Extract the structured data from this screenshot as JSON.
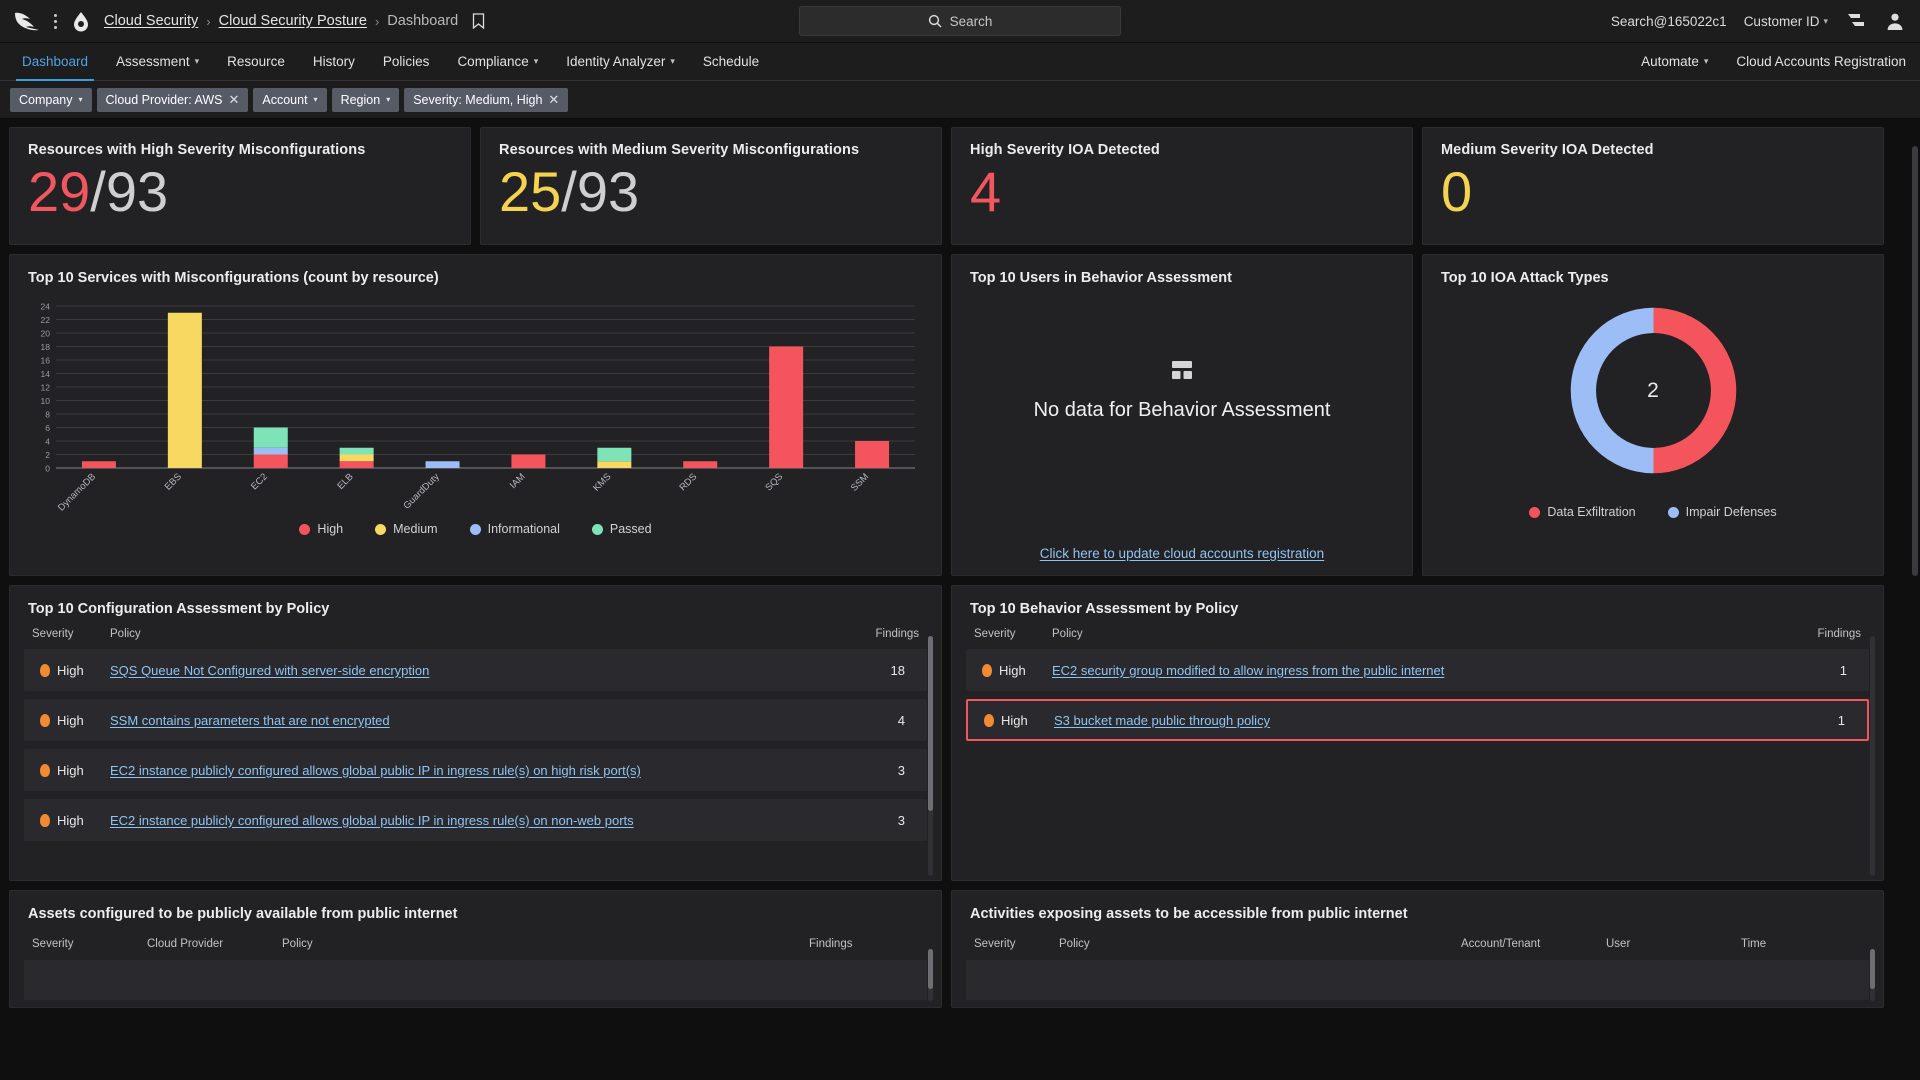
{
  "topbar": {
    "logo_icon": "falcon-logo",
    "menu_icon": "kebab-menu-icon",
    "product_icon": "cloud-security-shield-icon",
    "breadcrumb": [
      {
        "label": "Cloud Security",
        "link": true
      },
      {
        "label": "Cloud Security Posture",
        "link": true
      },
      {
        "label": "Dashboard",
        "link": false
      }
    ],
    "separator": "›",
    "bookmark_icon": "bookmark-icon",
    "search_placeholder": "Search",
    "search_icon": "search-icon",
    "search_value": "",
    "user_search": "Search@165022c1",
    "customer_id_label": "Customer ID",
    "chevron": "∨",
    "list_icon": "list-view-icon",
    "avatar_icon": "user-avatar-icon"
  },
  "nav": {
    "items": [
      {
        "label": "Dashboard",
        "active": true,
        "caret": false
      },
      {
        "label": "Assessment",
        "active": false,
        "caret": true
      },
      {
        "label": "Resource",
        "active": false,
        "caret": false
      },
      {
        "label": "History",
        "active": false,
        "caret": false
      },
      {
        "label": "Policies",
        "active": false,
        "caret": false
      },
      {
        "label": "Compliance",
        "active": false,
        "caret": true
      },
      {
        "label": "Identity Analyzer",
        "active": false,
        "caret": true
      },
      {
        "label": "Schedule",
        "active": false,
        "caret": false
      }
    ],
    "right_items": [
      {
        "label": "Automate",
        "caret": true
      },
      {
        "label": "Cloud Accounts Registration",
        "caret": false
      }
    ]
  },
  "filters": [
    {
      "label": "Company",
      "caret": true,
      "clear": false
    },
    {
      "label": "Cloud Provider: AWS",
      "caret": false,
      "clear": true
    },
    {
      "label": "Account",
      "caret": true,
      "clear": false
    },
    {
      "label": "Region",
      "caret": true,
      "clear": false
    },
    {
      "label": "Severity: Medium, High",
      "caret": false,
      "clear": true
    }
  ],
  "kpis": [
    {
      "title": "Resources with High Severity Misconfigurations",
      "value": "29",
      "denominator": "/93",
      "color": "#f2575f"
    },
    {
      "title": "Resources with Medium Severity Misconfigurations",
      "value": "25",
      "denominator": "/93",
      "color": "#f5d34e"
    },
    {
      "title": "High Severity IOA Detected",
      "value": "4",
      "denominator": "",
      "color": "#f2575f"
    },
    {
      "title": "Medium Severity IOA Detected",
      "value": "0",
      "denominator": "",
      "color": "#f5d34e"
    }
  ],
  "services_chart": {
    "title": "Top 10 Services with Misconfigurations (count by resource)"
  },
  "behavior_users": {
    "title": "Top 10 Users in Behavior Assessment",
    "empty_icon": "no-data-table-icon",
    "empty_text": "No data for Behavior Assessment",
    "link": "Click here to update cloud accounts registration"
  },
  "ioa_attacks": {
    "title": "Top 10 IOA Attack Types",
    "center_value": "2"
  },
  "config_table": {
    "title": "Top 10 Configuration Assessment by Policy",
    "columns": [
      "Severity",
      "Policy",
      "Findings"
    ],
    "rows": [
      {
        "severity": "High",
        "policy": "SQS Queue Not Configured with server-side encryption",
        "findings": "18",
        "highlighted": false
      },
      {
        "severity": "High",
        "policy": "SSM contains parameters that are not encrypted",
        "findings": "4",
        "highlighted": false
      },
      {
        "severity": "High",
        "policy": "EC2 instance publicly configured allows global public IP in ingress rule(s) on high risk port(s)",
        "findings": "3",
        "highlighted": false
      },
      {
        "severity": "High",
        "policy": "EC2 instance publicly configured allows global public IP in ingress rule(s) on non-web ports",
        "findings": "3",
        "highlighted": false
      }
    ]
  },
  "behavior_table": {
    "title": "Top 10 Behavior Assessment by Policy",
    "columns": [
      "Severity",
      "Policy",
      "Findings"
    ],
    "rows": [
      {
        "severity": "High",
        "policy": "EC2 security group modified to allow ingress from the public internet",
        "findings": "1",
        "highlighted": false
      },
      {
        "severity": "High",
        "policy": "S3 bucket made public through policy",
        "findings": "1",
        "highlighted": true
      }
    ]
  },
  "assets_table": {
    "title": "Assets configured to be publicly available from public internet",
    "columns": [
      "Severity",
      "Cloud Provider",
      "Policy",
      "Findings"
    ]
  },
  "activities_table": {
    "title": "Activities exposing assets to be accessible from public internet",
    "columns": [
      "Severity",
      "Policy",
      "Account/Tenant",
      "User",
      "Time"
    ]
  },
  "colors": {
    "high": "#f4555c",
    "medium": "#f7d861",
    "informational": "#9dbdf7",
    "passed": "#7fe3b8",
    "severity_badge": "#f08a33",
    "accent": "#3b9de0",
    "link": "#8fc4f1"
  },
  "chart_data": [
    {
      "type": "bar",
      "title": "Top 10 Services with Misconfigurations (count by resource)",
      "stacked": true,
      "xlabel": "",
      "ylabel": "",
      "ylim": [
        0,
        24
      ],
      "yticks": [
        0,
        2,
        4,
        6,
        8,
        10,
        12,
        14,
        16,
        18,
        20,
        22,
        24
      ],
      "grid": true,
      "legend_position": "bottom",
      "categories": [
        "DynamoDB",
        "EBS",
        "EC2",
        "ELB",
        "GuardDuty",
        "IAM",
        "KMS",
        "RDS",
        "SQS",
        "SSM"
      ],
      "series": [
        {
          "name": "High",
          "color": "#f4555c",
          "values": [
            1,
            0,
            2,
            1,
            0,
            2,
            0,
            1,
            18,
            4
          ]
        },
        {
          "name": "Medium",
          "color": "#f7d861",
          "values": [
            0,
            23,
            0,
            1,
            0,
            0,
            1,
            0,
            0,
            0
          ]
        },
        {
          "name": "Informational",
          "color": "#9dbdf7",
          "values": [
            0,
            0,
            1,
            0,
            1,
            0,
            0,
            0,
            0,
            0
          ]
        },
        {
          "name": "Passed",
          "color": "#7fe3b8",
          "values": [
            0,
            0,
            3,
            1,
            0,
            0,
            2,
            0,
            0,
            0
          ]
        }
      ]
    },
    {
      "type": "pie",
      "subtype": "donut",
      "title": "Top 10 IOA Attack Types",
      "center_label": "2",
      "legend_position": "bottom",
      "labels": [
        "Data Exfiltration",
        "Impair Defenses"
      ],
      "values": [
        1,
        1
      ],
      "colors": [
        "#f4555c",
        "#9dbdf7"
      ]
    }
  ]
}
